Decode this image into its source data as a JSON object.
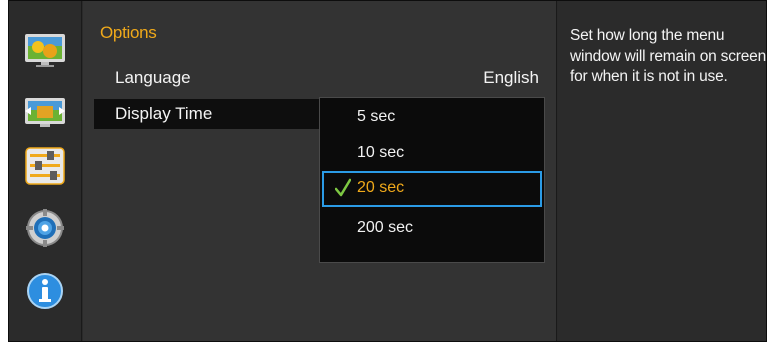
{
  "sidebar": {
    "items": [
      {
        "icon": "picture-icon"
      },
      {
        "icon": "screen-size-icon"
      },
      {
        "icon": "system-sliders-icon"
      },
      {
        "icon": "settings-gear-icon"
      },
      {
        "icon": "information-icon"
      }
    ],
    "active_index": 2
  },
  "menu": {
    "section_title": "Options",
    "rows": [
      {
        "label": "Language",
        "value": "English"
      },
      {
        "label": "Display Time",
        "value": ""
      }
    ]
  },
  "dropdown": {
    "options": [
      "5 sec",
      "10 sec",
      "20 sec",
      "200 sec"
    ],
    "selected_index": 2
  },
  "help": {
    "text": "Set how long the menu window will remain on screen for when it is not in use."
  },
  "colors": {
    "accent": "#f0a91a",
    "focus_border": "#2b9be6",
    "check": "#7ec843"
  }
}
